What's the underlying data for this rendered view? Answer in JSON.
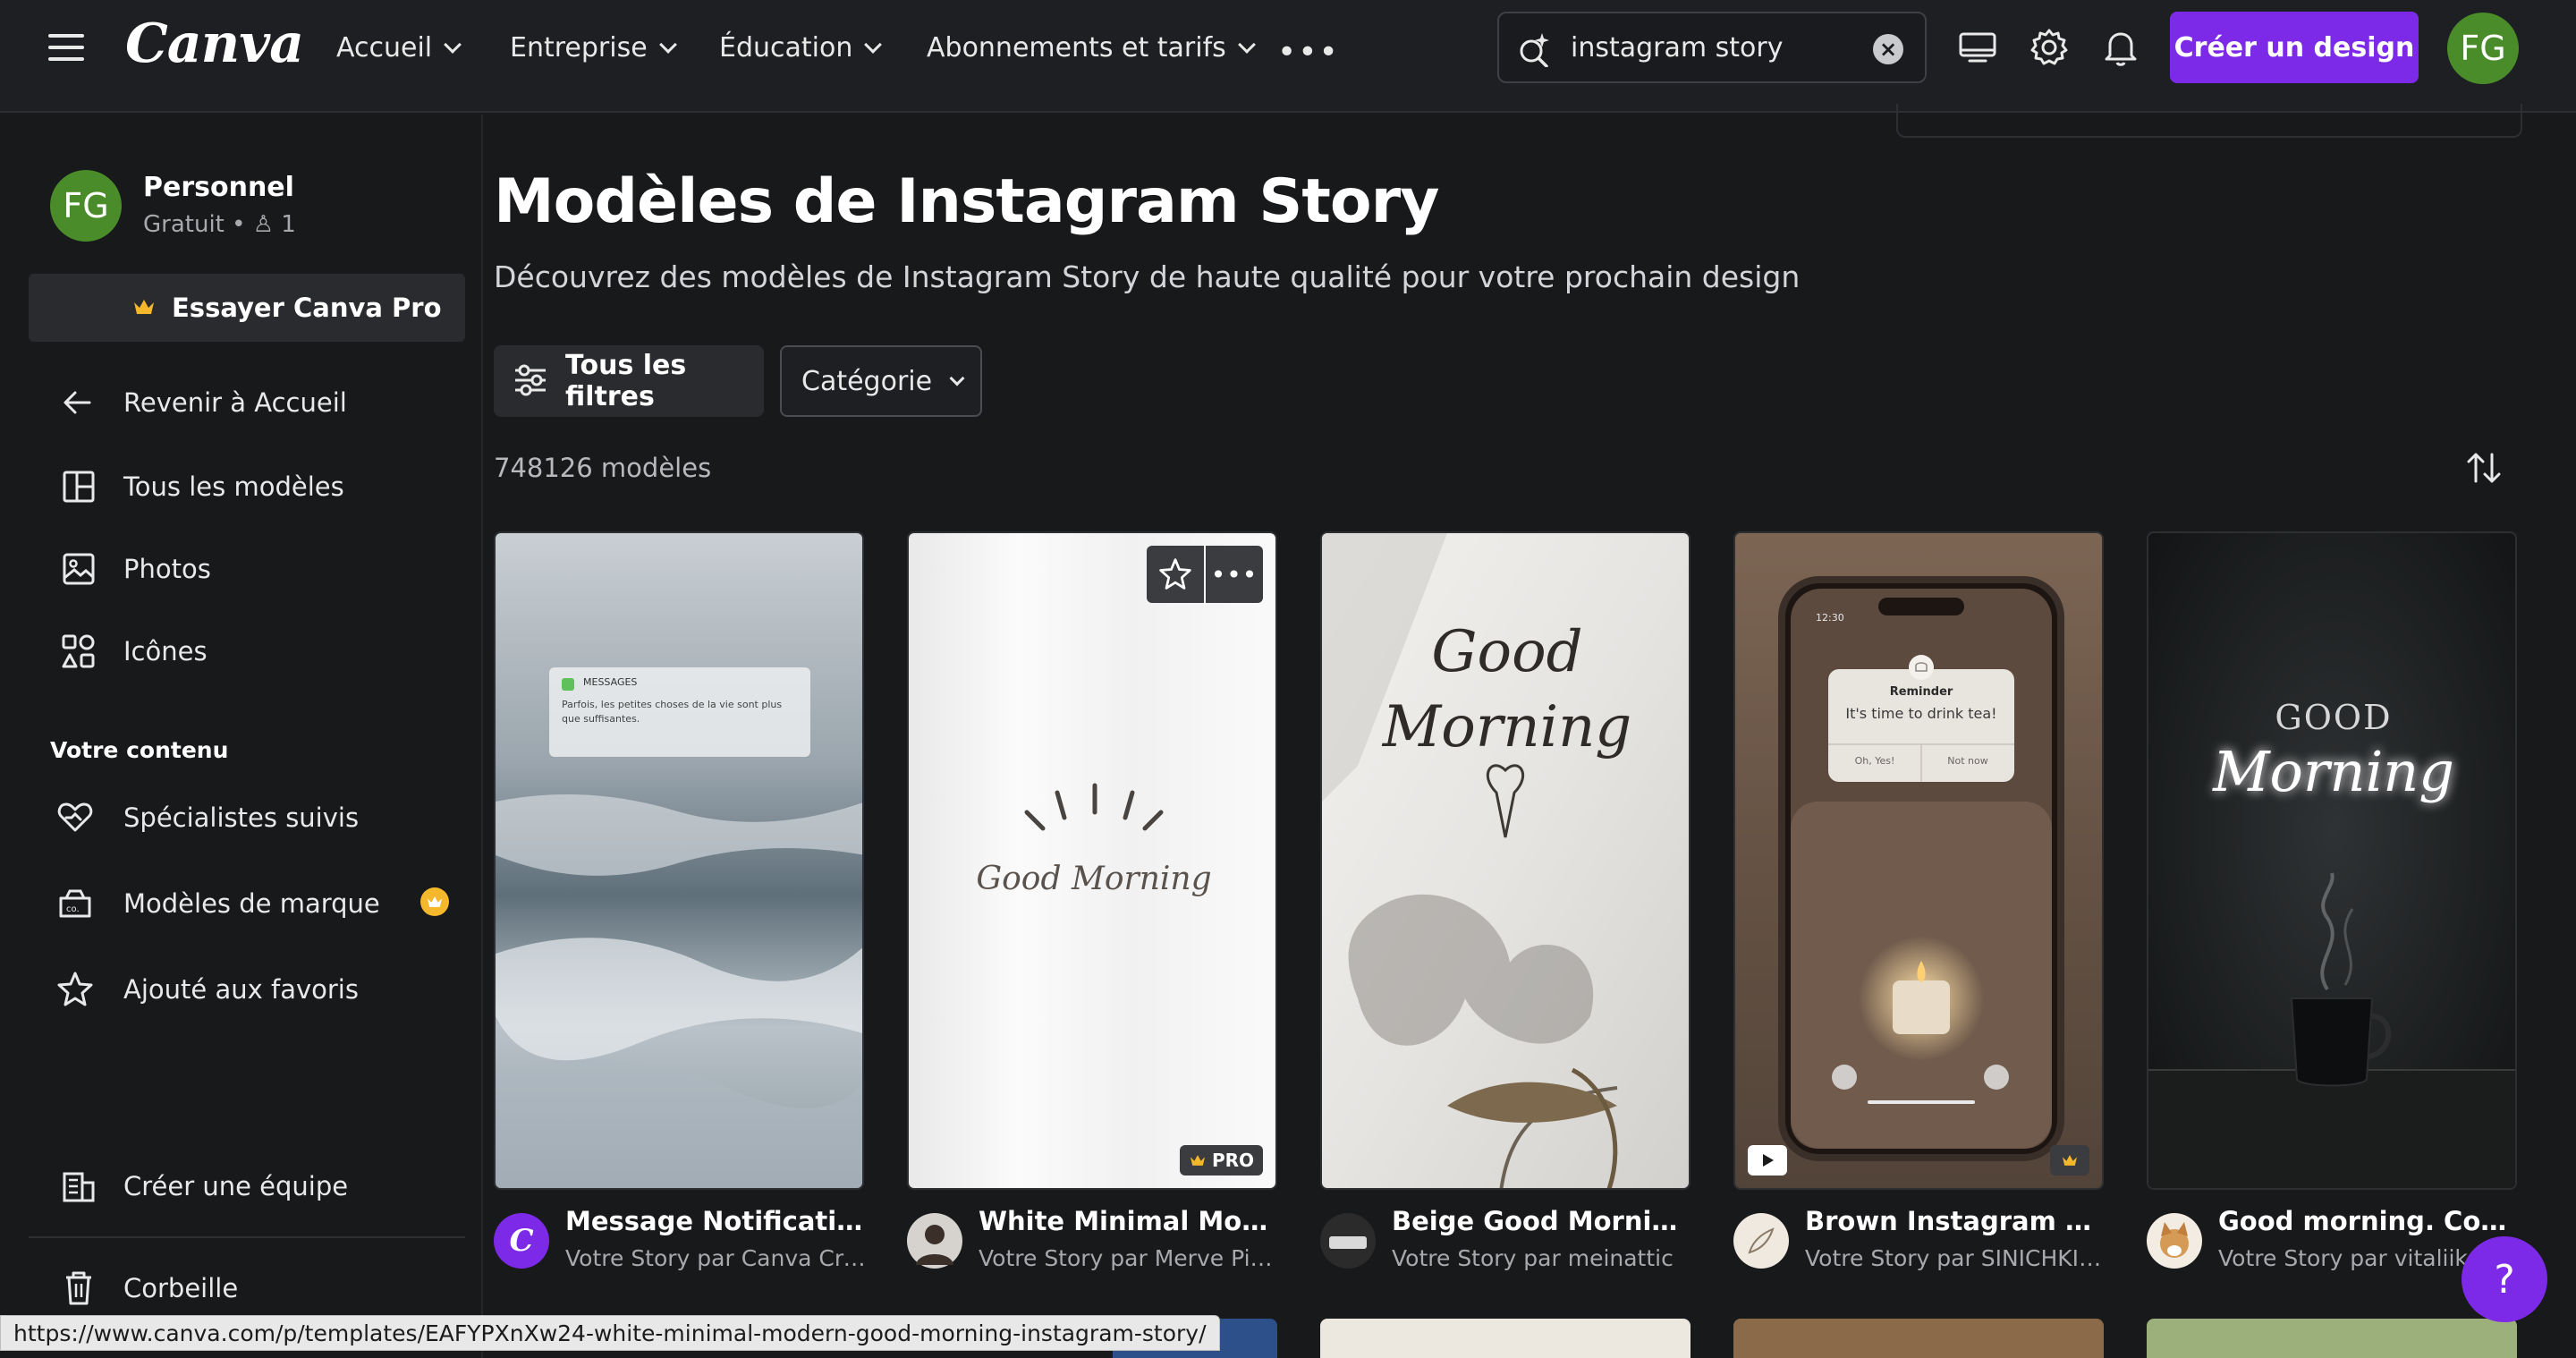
{
  "header": {
    "logo": "Canva",
    "nav": [
      {
        "label": "Accueil"
      },
      {
        "label": "Entreprise"
      },
      {
        "label": "Éducation"
      },
      {
        "label": "Abonnements et tarifs"
      }
    ],
    "more": "•••",
    "search": {
      "value": "instagram story",
      "placeholder": "instagram story"
    },
    "create_button": "Créer un design",
    "avatar_initials": "FG"
  },
  "sidebar": {
    "avatar_initials": "FG",
    "account_name": "Personnel",
    "account_plan": "Gratuit • ♙ 1",
    "try_pro": "Essayer Canva Pro",
    "items_top": [
      {
        "label": "Revenir à Accueil",
        "icon": "arrow-left-icon"
      },
      {
        "label": "Tous les modèles",
        "icon": "templates-icon"
      },
      {
        "label": "Photos",
        "icon": "photos-icon"
      },
      {
        "label": "Icônes",
        "icon": "shapes-icon"
      }
    ],
    "section_title": "Votre contenu",
    "items_content": [
      {
        "label": "Spécialistes suivis",
        "icon": "heart-hand-icon"
      },
      {
        "label": "Modèles de marque",
        "icon": "brand-kit-icon"
      },
      {
        "label": "Ajouté aux favoris",
        "icon": "star-icon"
      }
    ],
    "create_team": "Créer une équipe",
    "trash": "Corbeille"
  },
  "main": {
    "title": "Modèles de Instagram Story",
    "subtitle": "Découvrez des modèles de Instagram Story de haute qualité pour votre prochain design",
    "all_filters": "Tous les filtres",
    "category": "Catégorie",
    "count": "748126 modèles",
    "cards": [
      {
        "title": "Message Notification L...",
        "author": "Votre Story par Canva Crea...",
        "notif_app": "MESSAGES",
        "notif_text": "Parfois, les petites choses de la vie sont plus que suffisantes."
      },
      {
        "title": "White Minimal Modern...",
        "author": "Votre Story par Merve Pina...",
        "script_text": "Good Morning",
        "badge": "PRO"
      },
      {
        "title": "Beige Good Morning In...",
        "author": "Votre Story par meinattic",
        "script_text_1": "Good",
        "script_text_2": "Morning"
      },
      {
        "title": "Brown Instagram Story...",
        "author": "Votre Story par SINICHKIN ...",
        "reminder_title": "Reminder",
        "reminder_text": "It's time to drink tea!",
        "reminder_yes": "Oh, Yes!",
        "reminder_no": "Not now",
        "phone_time": "12:30"
      },
      {
        "title": "Good morning. Coffee. ...",
        "author": "Votre Story par vitaliikra...",
        "text_top": "GOOD",
        "text_script": "Morning"
      }
    ]
  },
  "status_url": "https://www.canva.com/p/templates/EAFYPXnXw24-white-minimal-modern-good-morning-instagram-story/",
  "help": "?",
  "colors": {
    "accent": "#7d2ae8",
    "avatar": "#4a8c2a",
    "crown": "#f5b72c",
    "background": "#18191b"
  }
}
